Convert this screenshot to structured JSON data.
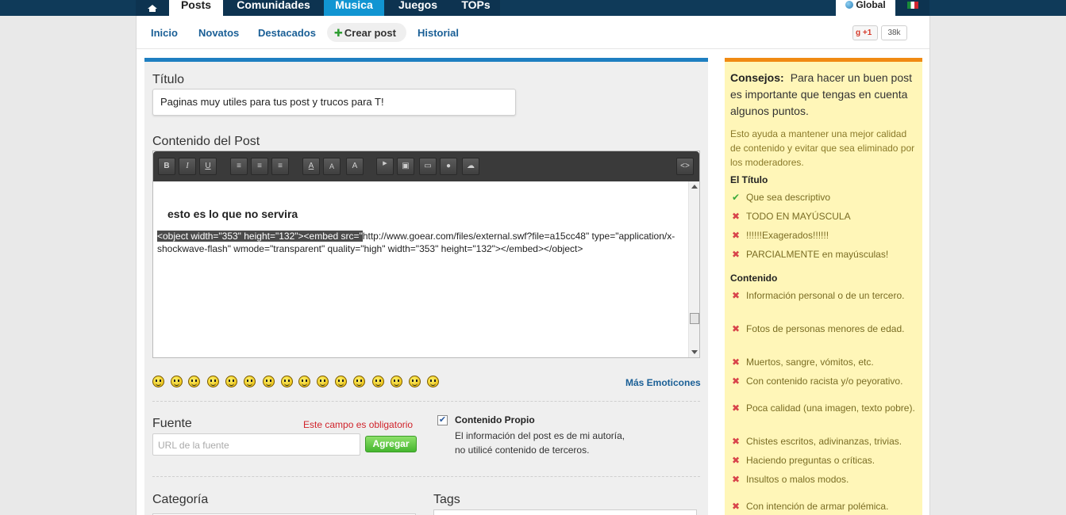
{
  "topnav": {
    "tabs": [
      "Posts",
      "Comunidades",
      "Musica",
      "Juegos",
      "TOPs"
    ],
    "global": "Global"
  },
  "subnav": {
    "inicio": "Inicio",
    "novatos": "Novatos",
    "destacados": "Destacados",
    "crear": "Crear post",
    "historial": "Historial",
    "gplus": "+1",
    "gcount": "38k"
  },
  "form": {
    "titulo_label": "Título",
    "titulo_value": "Paginas muy utiles para tus post y trucos para T!",
    "contenido_label": "Contenido del Post",
    "editor_heading": "esto es lo que no servira",
    "editor_code_selected": "<object width=\"353\" height=\"132\"><embed src=\"",
    "editor_code_rest": "http://www.goear.com/files/external.swf?file=a15cc48\" type=\"application/x-shockwave-flash\" wmode=\"transparent\" quality=\"high\" width=\"353\" height=\"132\"></embed></object>",
    "toolbar": [
      "B",
      "I",
      "U",
      "A",
      "A",
      "A"
    ],
    "mas_emoticones": "Más Emoticones",
    "fuente_label": "Fuente",
    "fuente_required": "Este campo es obligatorio",
    "fuente_placeholder": "URL de la fuente",
    "agregar": "Agregar",
    "propio_title": "Contenido Propio",
    "propio_desc": "El información del post es de mi autoría, no utilicé contenido de terceros.",
    "categoria_label": "Categoría",
    "tags_label": "Tags"
  },
  "tips": {
    "title": "Consejos:",
    "intro": "Para hacer un buen post es importante que tengas en cuenta algunos puntos.",
    "desc": "Esto ayuda a mantener una mejor calidad de contenido y evitar que sea eliminado por los moderadores.",
    "titulo_section": "El Título",
    "titulo_items": [
      "Que sea descriptivo",
      "TODO EN MAYÚSCULA",
      "!!!!!!Exagerados!!!!!!",
      "PARCIALMENTE en mayúsculas!"
    ],
    "contenido_section": "Contenido",
    "contenido_items": [
      "Información personal o de un tercero.",
      "Fotos de personas menores de edad.",
      "Muertos, sangre, vómitos, etc.",
      "Con contenido racista y/o peyorativo.",
      "Poca calidad (una imagen, texto pobre).",
      "Chistes escritos, adivinanzas, trivias.",
      "Haciendo preguntas o críticas.",
      "Insultos o malos modos.",
      "Con intención de armar polémica."
    ]
  },
  "colors": {
    "nav_bg": "#0f3a59",
    "accent_blue": "#1e7fc1",
    "accent_orange": "#f08a13",
    "tips_bg": "#fff6b8",
    "ok_green": "#3aa93a",
    "bad_red": "#d8444a"
  }
}
